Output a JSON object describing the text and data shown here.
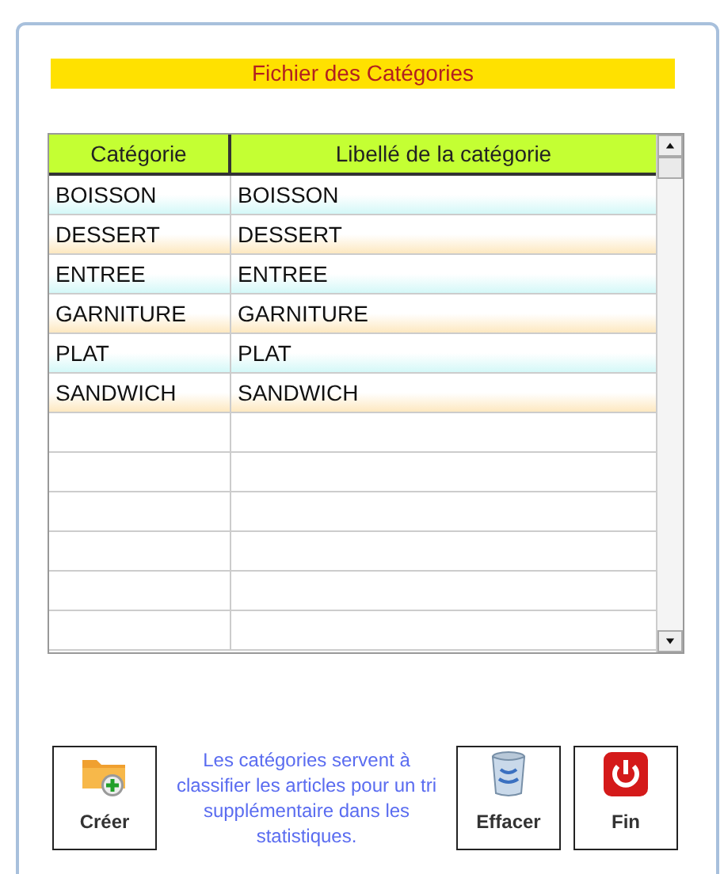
{
  "title": "Fichier des Catégories",
  "table": {
    "columns": [
      "Catégorie",
      "Libellé de la catégorie"
    ],
    "rows": [
      [
        "BOISSON",
        "BOISSON"
      ],
      [
        "DESSERT",
        "DESSERT"
      ],
      [
        "ENTREE",
        "ENTREE"
      ],
      [
        "GARNITURE",
        "GARNITURE"
      ],
      [
        "PLAT",
        "PLAT"
      ],
      [
        "SANDWICH",
        "SANDWICH"
      ]
    ]
  },
  "buttons": [
    {
      "kind": "create",
      "label": "Créer"
    },
    {
      "kind": "note",
      "text": "Les catégories servent à classifier les articles pour un tri supplémentaire dans les statistiques."
    },
    {
      "kind": "delete",
      "label": "Effacer"
    },
    {
      "kind": "exit",
      "label": "Fin"
    }
  ]
}
